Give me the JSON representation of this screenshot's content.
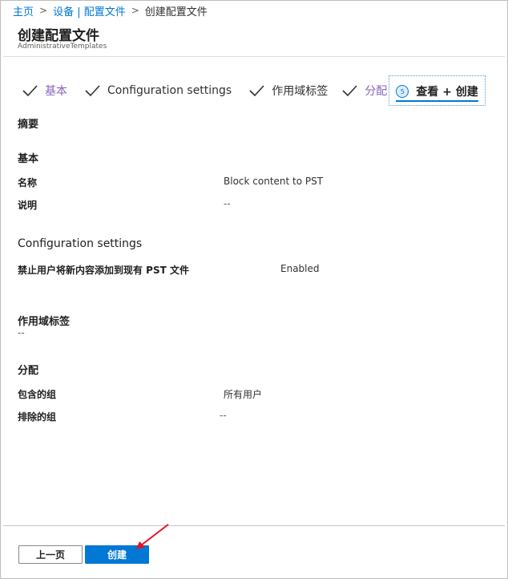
{
  "breadcrumb": {
    "items": [
      "主页",
      "设备 | 配置文件"
    ],
    "separator": ">",
    "current": "创建配置文件"
  },
  "header": {
    "title": "创建配置文件",
    "subtitle": "AdministrativeTemplates"
  },
  "wizard": {
    "steps": [
      {
        "label": "基本",
        "state": "completed"
      },
      {
        "label": "Configuration settings",
        "state": "completed"
      },
      {
        "label": "作用域标签",
        "state": "completed"
      },
      {
        "label": "分配",
        "state": "completed"
      }
    ],
    "active_step": {
      "number": "5",
      "label": "查看 + 创建"
    }
  },
  "summary": {
    "heading": "摘要",
    "basics": {
      "heading": "基本",
      "name_label": "名称",
      "name_value": "Block content to PST",
      "description_label": "说明",
      "description_value": "--"
    },
    "configuration": {
      "heading": "Configuration settings",
      "setting_label": "禁止用户将新内容添加到现有 PST 文件",
      "setting_value": "Enabled"
    },
    "scope_tags": {
      "heading": "作用域标签",
      "value": "--"
    },
    "assignments": {
      "heading": "分配",
      "included_label": "包含的组",
      "included_value": "所有用户",
      "excluded_label": "排除的组",
      "excluded_value": "--"
    }
  },
  "footer": {
    "prev_label": "上一页",
    "create_label": "创建"
  },
  "colors": {
    "accent": "#0078d4",
    "completed_step": "#8764b8",
    "annotation_arrow": "#e81123"
  }
}
